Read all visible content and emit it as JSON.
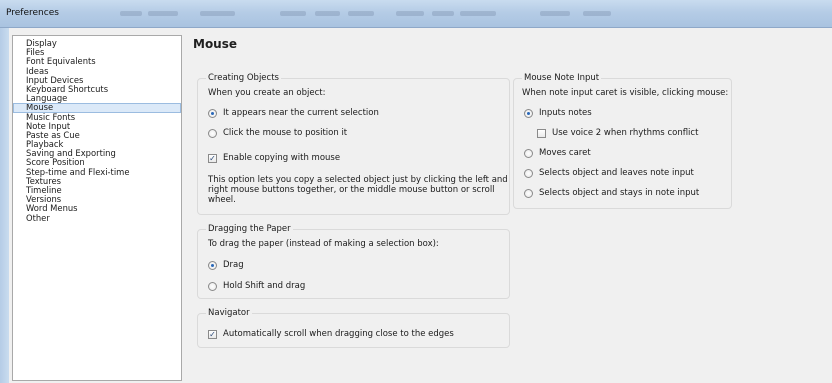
{
  "window": {
    "title": "Preferences"
  },
  "categories": [
    {
      "label": "Display",
      "selected": false
    },
    {
      "label": "Files",
      "selected": false
    },
    {
      "label": "Font Equivalents",
      "selected": false
    },
    {
      "label": "Ideas",
      "selected": false
    },
    {
      "label": "Input Devices",
      "selected": false
    },
    {
      "label": "Keyboard Shortcuts",
      "selected": false
    },
    {
      "label": "Language",
      "selected": false
    },
    {
      "label": "Mouse",
      "selected": true
    },
    {
      "label": "Music Fonts",
      "selected": false
    },
    {
      "label": "Note Input",
      "selected": false
    },
    {
      "label": "Paste as Cue",
      "selected": false
    },
    {
      "label": "Playback",
      "selected": false
    },
    {
      "label": "Saving and Exporting",
      "selected": false
    },
    {
      "label": "Score Position",
      "selected": false
    },
    {
      "label": "Step-time and Flexi-time",
      "selected": false
    },
    {
      "label": "Textures",
      "selected": false
    },
    {
      "label": "Timeline",
      "selected": false
    },
    {
      "label": "Versions",
      "selected": false
    },
    {
      "label": "Word Menus",
      "selected": false
    },
    {
      "label": "Other",
      "selected": false
    }
  ],
  "page": {
    "heading": "Mouse"
  },
  "creating_objects": {
    "title": "Creating Objects",
    "prompt": "When you create an object:",
    "option_near_selection": "It appears near the current selection",
    "option_click_position": "Click the mouse to position it",
    "enable_copying_label": "Enable copying with mouse",
    "enable_copying_checked": true,
    "description": "This option lets you copy a selected object just by clicking the left and right mouse buttons together, or the middle mouse button or scroll wheel."
  },
  "dragging_paper": {
    "title": "Dragging the Paper",
    "prompt": "To drag the paper (instead of making a selection box):",
    "option_drag": "Drag",
    "option_hold_shift": "Hold Shift and drag"
  },
  "navigator": {
    "title": "Navigator",
    "auto_scroll_label": "Automatically scroll when dragging close to the edges",
    "auto_scroll_checked": true
  },
  "mouse_note_input": {
    "title": "Mouse Note Input",
    "prompt": "When note input caret is visible, clicking mouse:",
    "option_inputs_notes": "Inputs notes",
    "use_voice2_label": "Use voice 2 when rhythms conflict",
    "use_voice2_checked": false,
    "option_moves_caret": "Moves caret",
    "option_selects_leaves": "Selects object and leaves note input",
    "option_selects_stays": "Selects object and stays in note input"
  },
  "check_mark": "✓"
}
